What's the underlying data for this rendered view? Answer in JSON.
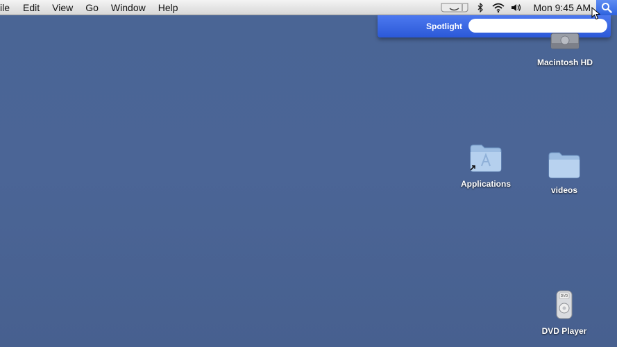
{
  "menubar": {
    "menus": [
      "ile",
      "Edit",
      "View",
      "Go",
      "Window",
      "Help"
    ],
    "status_icons": [
      "time-machine-icon",
      "bluetooth-icon",
      "wifi-icon",
      "volume-icon"
    ],
    "clock": "Mon 9:45 AM",
    "spotlight_icon": "magnifier-icon"
  },
  "spotlight": {
    "label": "Spotlight",
    "value": "",
    "placeholder": ""
  },
  "desktop": {
    "icons": [
      {
        "label": "Macintosh HD",
        "icon": "hard-drive-icon"
      },
      {
        "label": "Applications",
        "icon": "applications-folder-alias-icon"
      },
      {
        "label": "videos",
        "icon": "folder-icon"
      },
      {
        "label": "DVD Player",
        "icon": "dvd-player-icon"
      }
    ]
  },
  "colors": {
    "desktop_bg": "#4a6595",
    "spotlight_bg": "#2b59d8",
    "folder_blue": "#a8c7e8"
  }
}
